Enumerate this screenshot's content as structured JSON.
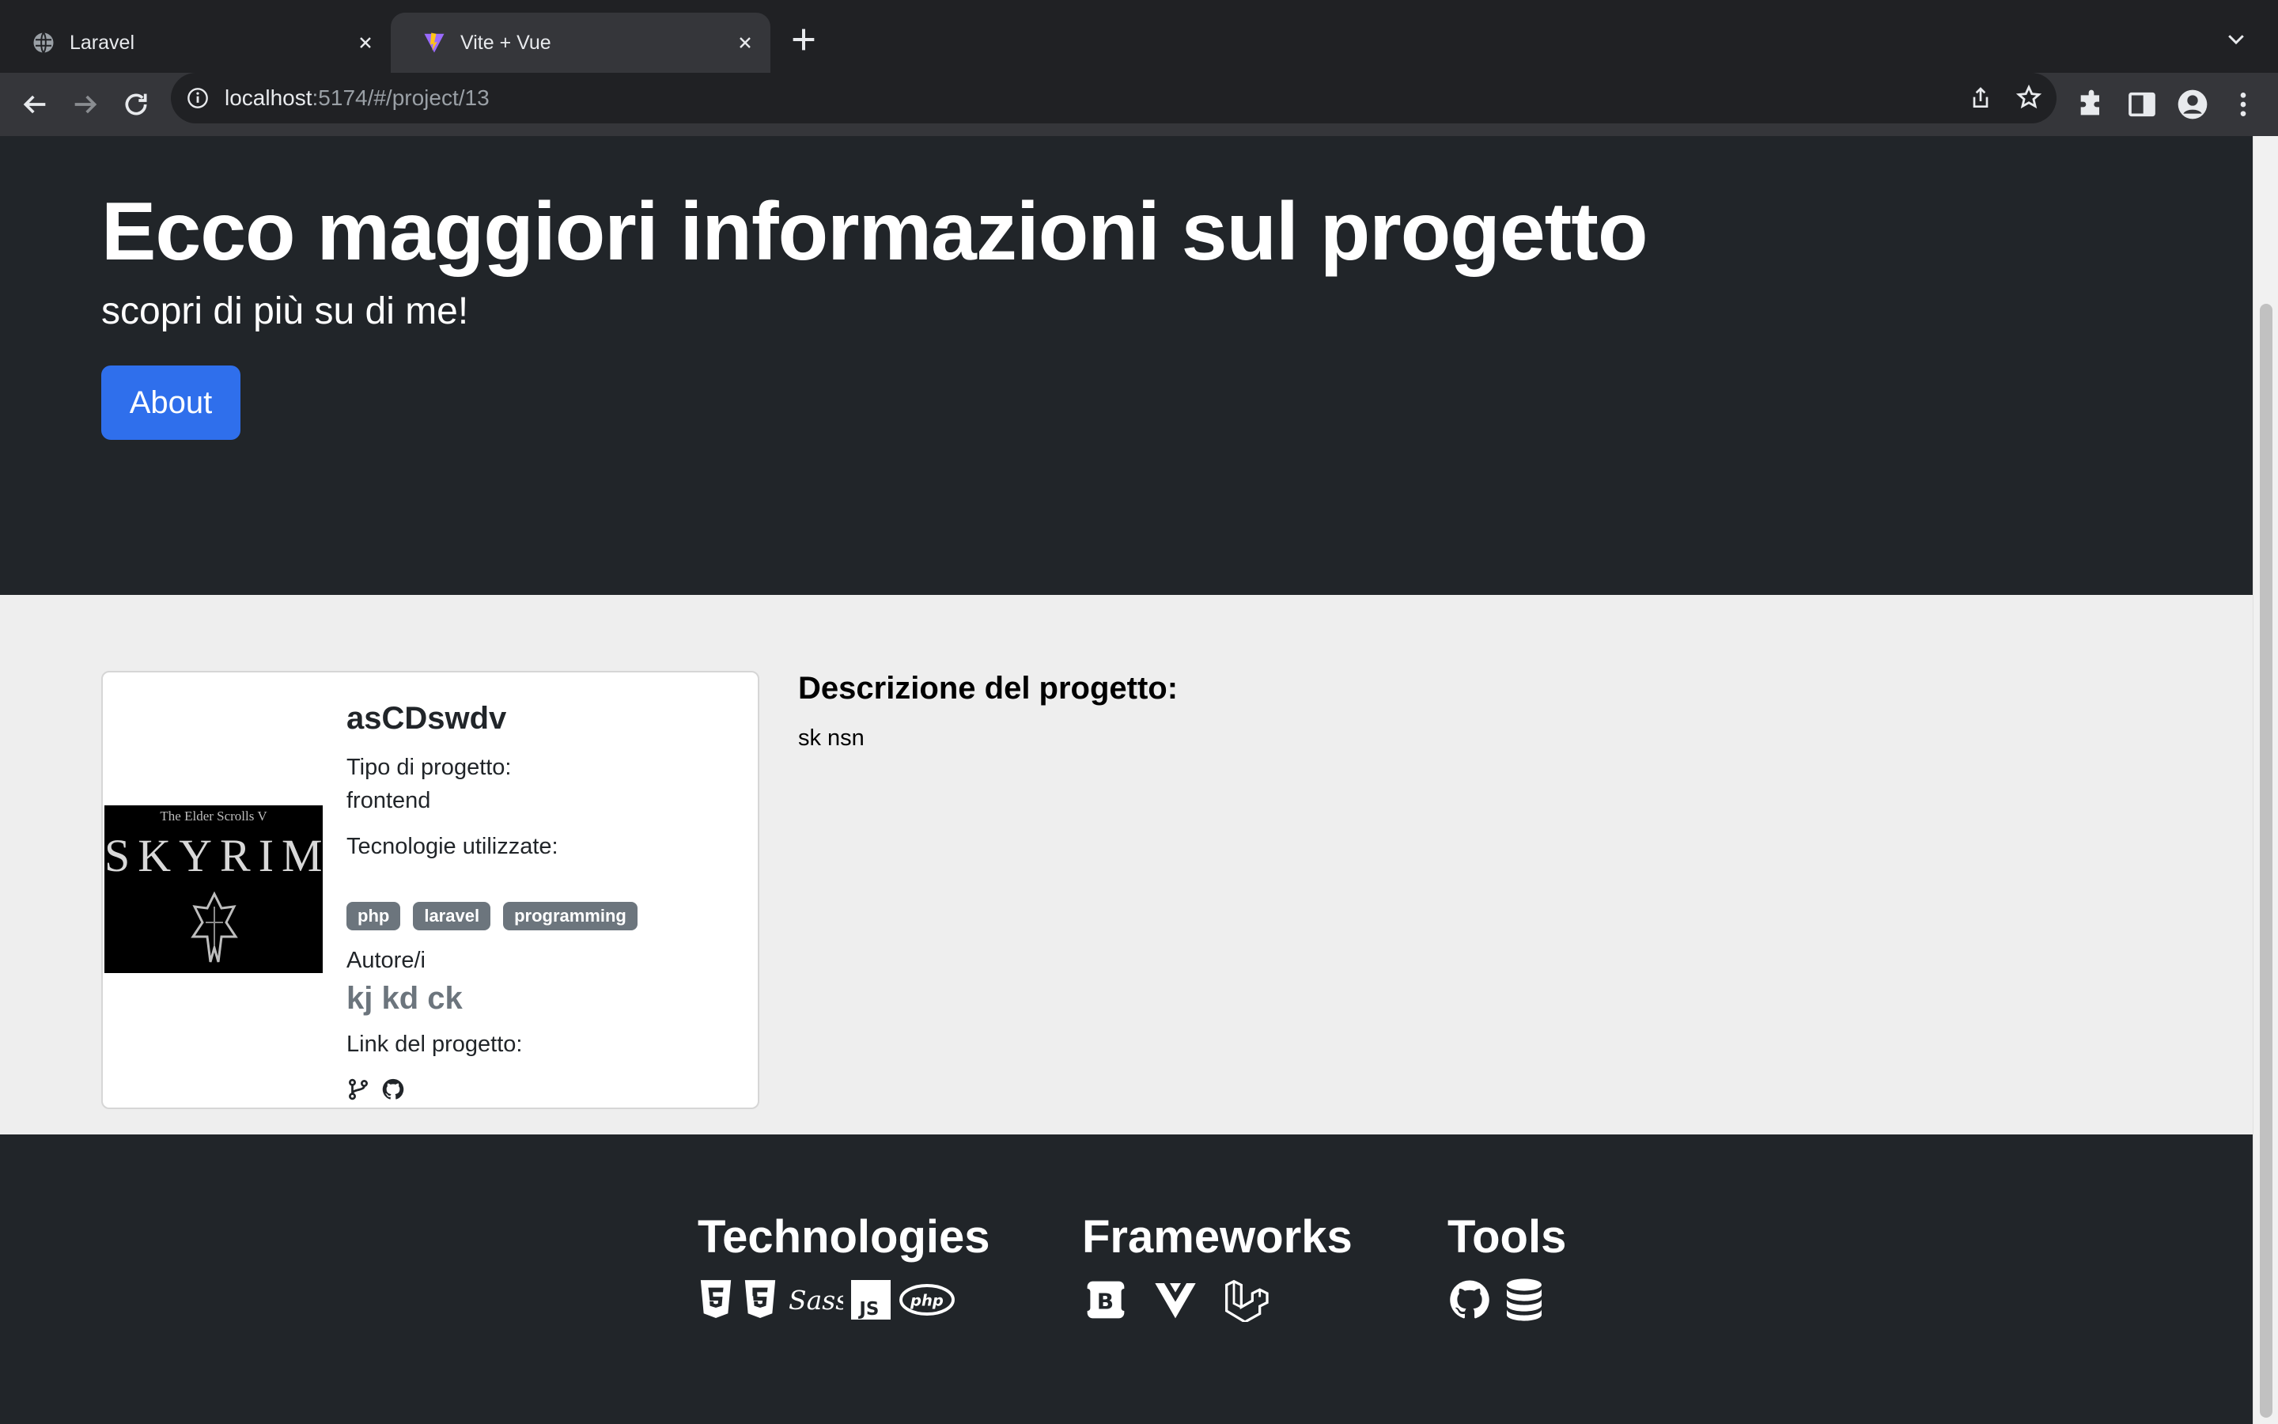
{
  "browser": {
    "tabs": [
      {
        "title": "Laravel",
        "icon": "globe-icon",
        "active": false
      },
      {
        "title": "Vite + Vue",
        "icon": "vite-logo-icon",
        "active": true
      }
    ],
    "url_host": "localhost",
    "url_path": ":5174/#/project/13"
  },
  "hero": {
    "title": "Ecco maggiori informazioni sul progetto",
    "subtitle": "scopri di più su di me!",
    "about_button": "About"
  },
  "project": {
    "cover": {
      "top_text": "The Elder Scrolls V",
      "title": "SKYRIM"
    },
    "title": "asCDswdv",
    "type_label": "Tipo di progetto:",
    "type_value": "frontend",
    "tech_label": "Tecnologie utilizzate:",
    "technologies": [
      "php",
      "laravel",
      "programming"
    ],
    "authors_label": "Autore/i",
    "authors": "kj kd ck",
    "links_label": "Link del progetto:",
    "links": [
      "git-branch-icon",
      "github-icon"
    ]
  },
  "description": {
    "heading": "Descrizione del progetto:",
    "text": "sk nsn"
  },
  "footer": {
    "technologies": {
      "title": "Technologies",
      "icons": [
        "html5-icon",
        "css3-icon",
        "sass-icon",
        "js-icon",
        "php-icon"
      ]
    },
    "frameworks": {
      "title": "Frameworks",
      "icons": [
        "bootstrap-icon",
        "vue-icon",
        "laravel-icon"
      ]
    },
    "tools": {
      "title": "Tools",
      "icons": [
        "github-icon",
        "database-icon"
      ]
    }
  },
  "colors": {
    "page_dark": "#212529",
    "content_bg": "#eeeeee",
    "primary": "#2f6fec",
    "badge": "#6c757d"
  }
}
